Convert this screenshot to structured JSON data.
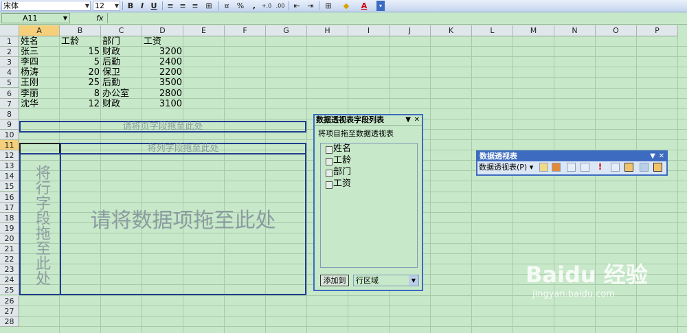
{
  "toolbar": {
    "font_name": "宋体",
    "font_size": "12",
    "bold": "B",
    "italic": "I",
    "underline": "U",
    "percent": "%",
    "comma": ",",
    "font_color": "A"
  },
  "formula_bar": {
    "name_box": "A11",
    "fx": "fx",
    "value": ""
  },
  "columns": [
    "A",
    "B",
    "C",
    "D",
    "E",
    "F",
    "G",
    "H",
    "I",
    "J",
    "K",
    "L",
    "M",
    "N",
    "O",
    "P"
  ],
  "rows": [
    "1",
    "2",
    "3",
    "4",
    "5",
    "6",
    "7",
    "8",
    "9",
    "10",
    "11",
    "12",
    "13",
    "14",
    "15",
    "16",
    "17",
    "18",
    "19",
    "20",
    "21",
    "22",
    "23",
    "24",
    "25",
    "26",
    "27",
    "28"
  ],
  "table": {
    "headers": [
      "姓名",
      "工龄",
      "部门",
      "工资"
    ],
    "rows": [
      [
        "张三",
        "15",
        "财政",
        "3200"
      ],
      [
        "李四",
        "5",
        "后勤",
        "2400"
      ],
      [
        "杨涛",
        "20",
        "保卫",
        "2200"
      ],
      [
        "王刚",
        "25",
        "后勤",
        "3500"
      ],
      [
        "李丽",
        "8",
        "办公室",
        "2800"
      ],
      [
        "沈华",
        "12",
        "财政",
        "3100"
      ]
    ]
  },
  "pivot": {
    "page_zone": "请将页字段拖至此处",
    "column_zone": "将列字段拖至此处",
    "row_zone": "将行字段拖至此处",
    "data_zone": "请将数据项拖至此处"
  },
  "field_list": {
    "title": "数据透视表字段列表",
    "subtitle": "将项目拖至数据透视表",
    "fields": [
      "姓名",
      "工龄",
      "部门",
      "工资"
    ],
    "add_button": "添加到",
    "area_select": "行区域"
  },
  "pivot_toolbar": {
    "title": "数据透视表",
    "menu": "数据透视表(P)"
  },
  "watermark": {
    "logo": "Baidu 经验",
    "url": "jingyan.baidu.com"
  }
}
